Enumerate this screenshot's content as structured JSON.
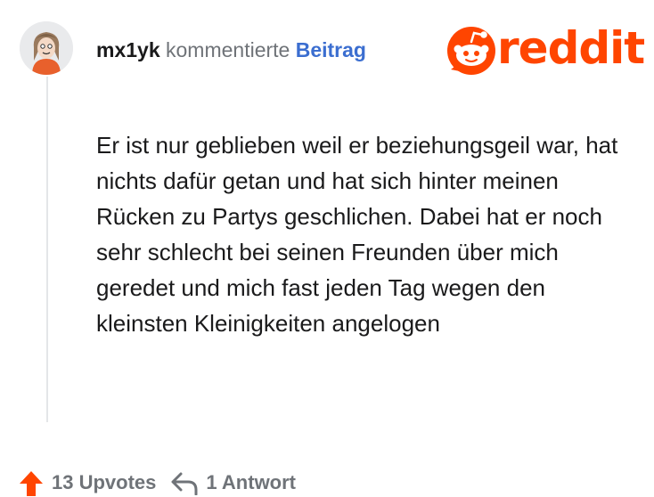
{
  "comment": {
    "username": "mx1yk",
    "action_text": "kommentierte",
    "post_link": "Beitrag",
    "body": "Er ist nur geblieben weil er beziehungsgeil war, hat nichts dafür getan und hat sich hinter meinen Rücken zu Partys geschlichen. Dabei hat er noch sehr schlecht bei seinen Freunden über mich geredet und mich fast jeden Tag wegen den kleinsten Kleinigkeiten angelogen"
  },
  "branding": {
    "wordmark": "reddit",
    "brand_color": "#ff4500"
  },
  "footer": {
    "upvotes_label": "13 Upvotes",
    "replies_label": "1 Antwort"
  },
  "icons": {
    "avatar": "avatar",
    "logo": "reddit-snoo-icon",
    "upvote": "upvote-arrow-icon",
    "reply": "reply-arrow-icon"
  },
  "colors": {
    "username": "#1a1a1b",
    "link": "#3b6ed0",
    "muted": "#6f7378",
    "upvote": "#ff4500"
  }
}
